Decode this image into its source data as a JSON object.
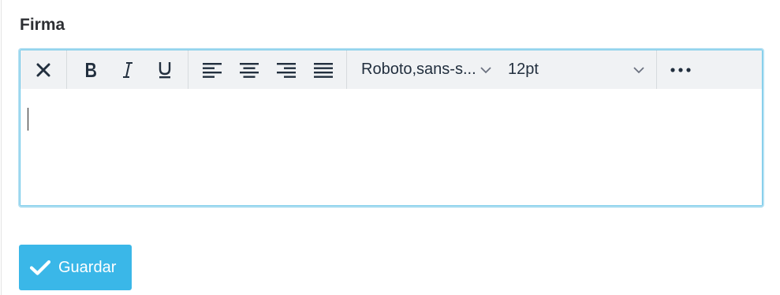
{
  "field": {
    "label": "Firma"
  },
  "toolbar": {
    "font_family": "Roboto,sans-s...",
    "font_size": "12pt",
    "icons": [
      "close-icon",
      "bold-icon",
      "italic-icon",
      "underline-icon",
      "align-left-icon",
      "align-center-icon",
      "align-right-icon",
      "align-justify-icon",
      "chevron-down-icon",
      "more-icon"
    ]
  },
  "editor": {
    "content": ""
  },
  "actions": {
    "save_label": "Guardar"
  },
  "colors": {
    "accent": "#3ab7e8",
    "focus_border": "#6cc6e8",
    "toolbar_bg": "#f0f2f4",
    "icon": "#222f3e"
  }
}
